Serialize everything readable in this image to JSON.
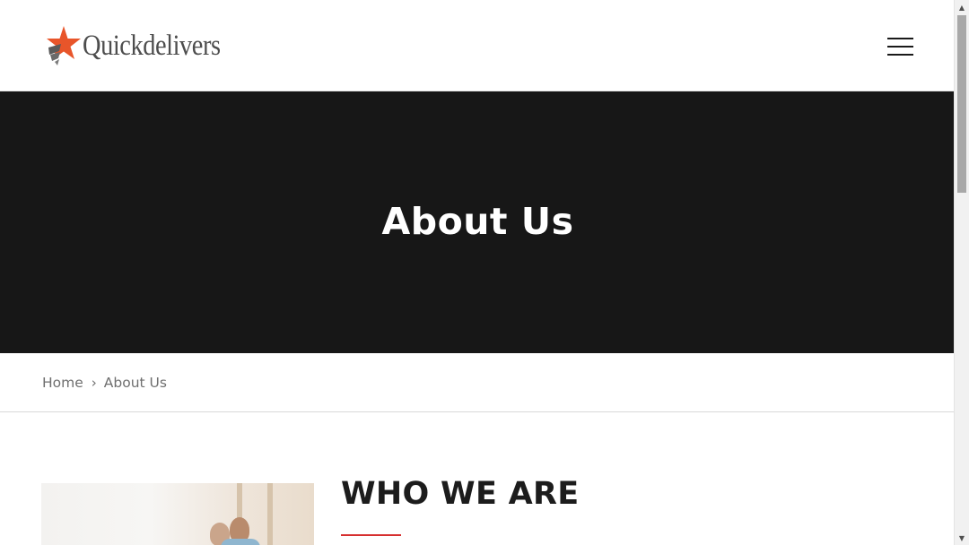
{
  "header": {
    "logo_text": "Quickdelivers",
    "logo_icon": "star-logo-icon",
    "menu_icon": "hamburger-menu-icon"
  },
  "hero": {
    "title": "About Us",
    "background": "#171717"
  },
  "breadcrumb": {
    "home": "Home",
    "separator": "›",
    "current": "About Us"
  },
  "content": {
    "section_title": "WHO WE ARE",
    "accent_color": "#d62f2f",
    "image_alt": "team-photo"
  },
  "scrollbar": {
    "up_arrow": "▲",
    "down_arrow": "▼"
  }
}
